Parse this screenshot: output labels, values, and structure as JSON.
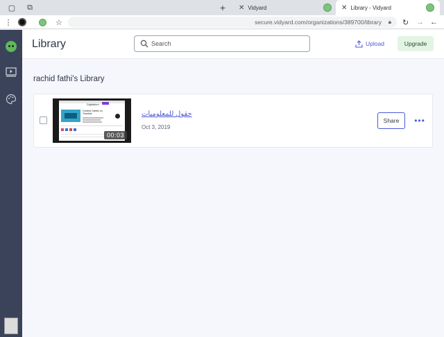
{
  "browser": {
    "tabs": [
      {
        "label": "Vidyard",
        "active": false
      },
      {
        "label": "Library - Vidyard",
        "active": true
      }
    ],
    "url": "secure.vidyard.com/organizations/389700/library"
  },
  "header": {
    "title": "Library",
    "search_placeholder": "Search",
    "upload_label": "Upload",
    "upgrade_label": "Upgrade"
  },
  "library": {
    "heading": "rachid fathi's Library",
    "videos": [
      {
        "title": "حقول للمعلوميات",
        "date": "Oct 3, 2019",
        "duration": "00:03",
        "share_label": "Share",
        "more_label": "•••"
      }
    ]
  },
  "thumbnail": {
    "brand_text": "Digitalbird",
    "headline": "Contest Cables on Thankful"
  },
  "colors": {
    "sidebar": "#3a4359",
    "accent": "#4a57d8",
    "upgrade_bg": "#e3f4e4",
    "page_bg": "#f5f7fc"
  }
}
